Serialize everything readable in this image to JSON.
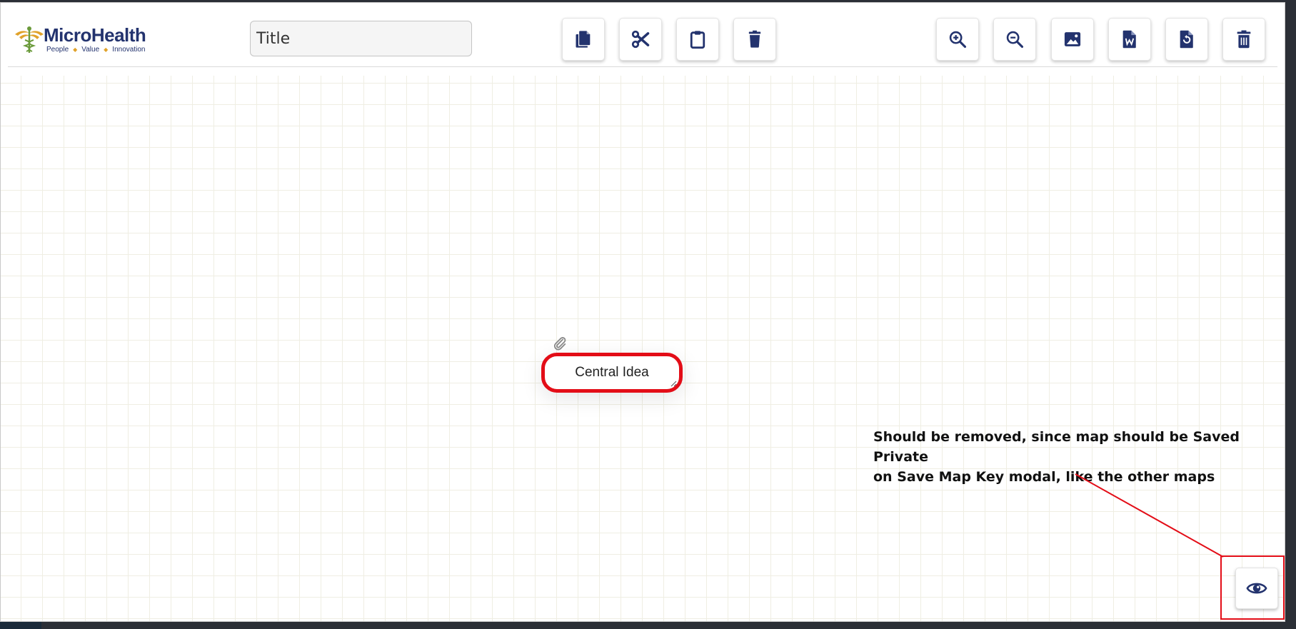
{
  "logo": {
    "brand": "MicroHealth",
    "tagline": [
      "People",
      "Value",
      "Innovation"
    ],
    "icon": "caduceus-icon"
  },
  "title_input": {
    "placeholder": "Title",
    "value": ""
  },
  "toolbar_left": [
    {
      "name": "copy-button",
      "icon": "copy-icon"
    },
    {
      "name": "cut-button",
      "icon": "scissors-icon"
    },
    {
      "name": "paste-button",
      "icon": "clipboard-icon"
    },
    {
      "name": "delete-node-button",
      "icon": "trash-icon"
    }
  ],
  "toolbar_right": [
    {
      "name": "zoom-in-button",
      "icon": "zoom-in-icon"
    },
    {
      "name": "zoom-out-button",
      "icon": "zoom-out-icon"
    },
    {
      "name": "export-image-button",
      "icon": "image-icon"
    },
    {
      "name": "export-word-button",
      "icon": "word-file-icon"
    },
    {
      "name": "reset-button",
      "icon": "file-reset-icon"
    },
    {
      "name": "delete-map-button",
      "icon": "trash-can-icon"
    }
  ],
  "canvas": {
    "central_node": {
      "label": "Central Idea"
    }
  },
  "annotation": {
    "line1": "Should be removed, since map should be Saved Private",
    "line2": "on Save Map Key modal, like the other maps"
  },
  "visibility_button": {
    "icon": "eye-icon"
  },
  "colors": {
    "brand_navy": "#23336e",
    "accent_red": "#e30d17",
    "logo_gold": "#e0a22a",
    "logo_green": "#6a9a3a"
  }
}
